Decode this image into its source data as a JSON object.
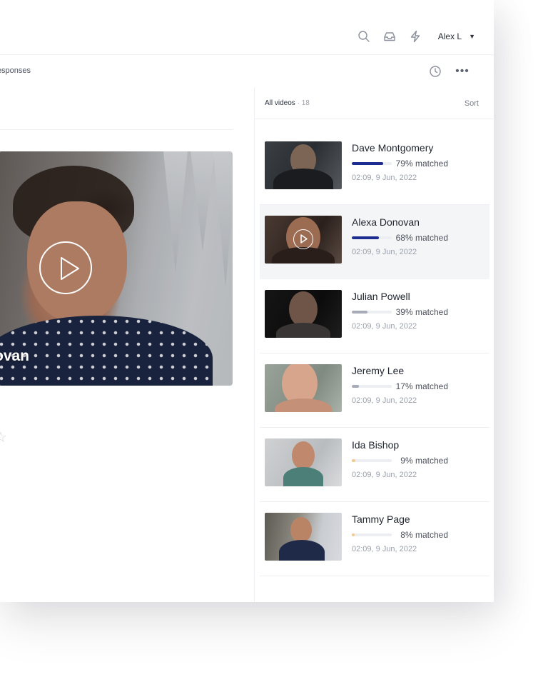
{
  "header": {
    "user_name": "Alex L",
    "icons": [
      "search-icon",
      "inbox-icon",
      "lightning-icon",
      "caret-down-icon"
    ]
  },
  "subheader": {
    "breadcrumb": "Responses",
    "icons": [
      "clock-icon",
      "more-icon"
    ],
    "more_label": "•••"
  },
  "player": {
    "name_partial": "ovan",
    "star_glyph": "☆"
  },
  "list": {
    "title": "All videos",
    "count": "· 18",
    "sort_label": "Sort",
    "items": [
      {
        "name": "Dave Montgomery",
        "match": 79,
        "match_label": "79% matched",
        "meta": "02:09, 9 Jun, 2022",
        "bar_color": "#1e2b8f"
      },
      {
        "name": "Alexa Donovan",
        "match": 68,
        "match_label": "68% matched",
        "meta": "02:09, 9 Jun, 2022",
        "bar_color": "#1e2b8f",
        "active": true
      },
      {
        "name": "Julian Powell",
        "match": 39,
        "match_label": "39% matched",
        "meta": "02:09, 9 Jun, 2022",
        "bar_color": "#a6abb8"
      },
      {
        "name": "Jeremy Lee",
        "match": 17,
        "match_label": "17% matched",
        "meta": "02:09, 9 Jun, 2022",
        "bar_color": "#a6abb8"
      },
      {
        "name": "Ida Bishop",
        "match": 9,
        "match_label": "9% matched",
        "meta": "02:09, 9 Jun, 2022",
        "bar_color": "#f6c98a"
      },
      {
        "name": "Tammy Page",
        "match": 8,
        "match_label": "8% matched",
        "meta": "02:09, 9 Jun, 2022",
        "bar_color": "#f6c98a"
      }
    ]
  },
  "colors": {
    "accent": "#1e2b8f",
    "neutral_bar": "#a6abb8",
    "warning_bar": "#f6c98a",
    "active_row": "#f4f5f7"
  }
}
